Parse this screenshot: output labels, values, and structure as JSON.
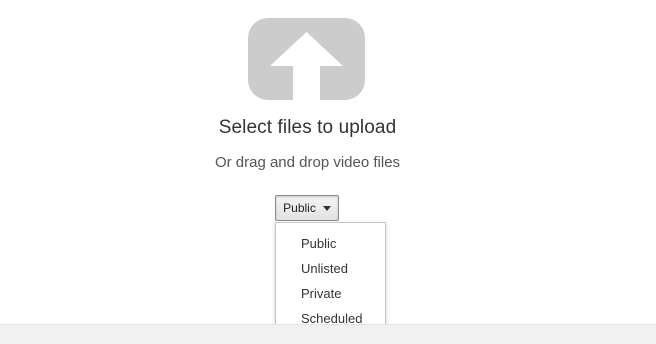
{
  "upload": {
    "icon": "upload-arrow-icon",
    "title": "Select files to upload",
    "subtitle": "Or drag and drop video files"
  },
  "privacy": {
    "selected": "Public",
    "options": [
      "Public",
      "Unlisted",
      "Private",
      "Scheduled"
    ]
  },
  "colors": {
    "icon_gray": "#cccccc",
    "text_dark": "#333333",
    "text_muted": "#555555"
  }
}
